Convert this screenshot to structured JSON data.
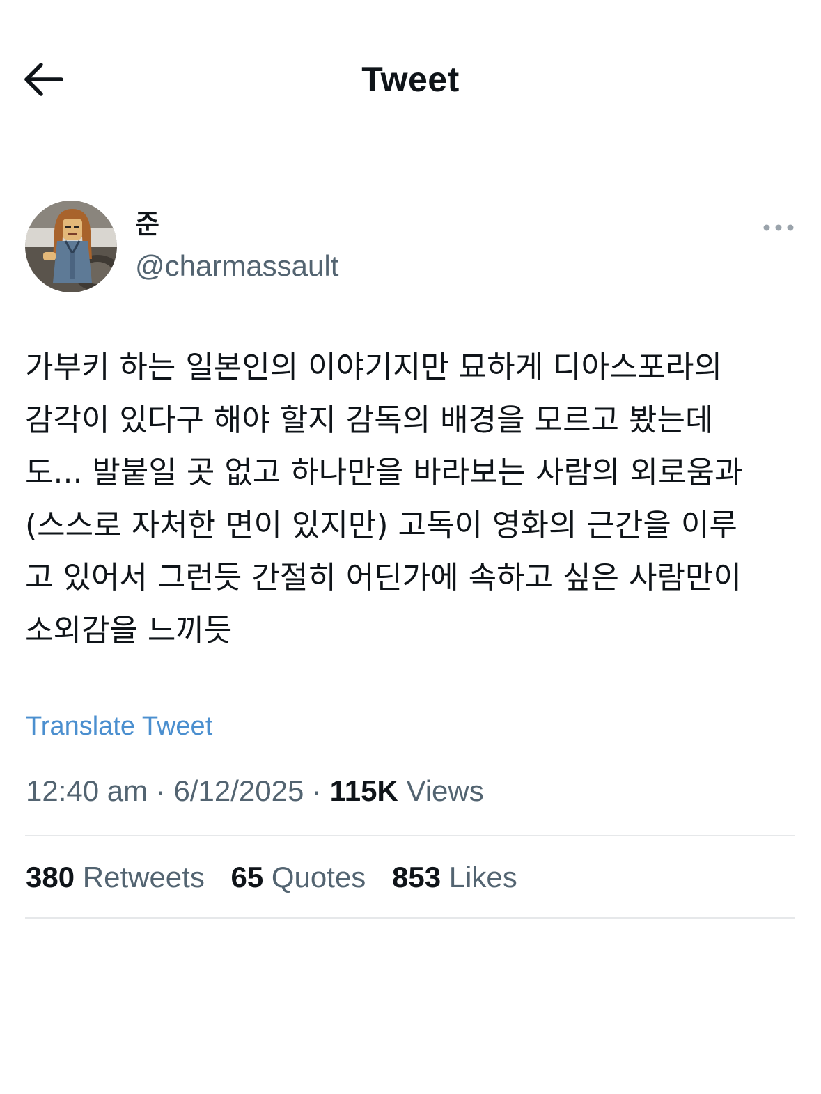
{
  "header": {
    "title": "Tweet",
    "back_icon": "arrow-left-icon"
  },
  "author": {
    "display_name": "준",
    "handle": "@charmassault",
    "avatar_icon": "avatar-image",
    "more_icon": "more-options-icon"
  },
  "tweet": {
    "lines": [
      "가부키 하는 일본인의 이야기지만 묘하게 디아스포라의",
      "감각이 있다구 해야 할지 감독의 배경을 모르고 봤는데",
      "도... 발붙일 곳 없고 하나만을 바라보는 사람의 외로움과",
      "(스스로 자처한 면이 있지만) 고독이 영화의 근간을 이루",
      "고 있어서 그런듯 간절히 어딘가에 속하고 싶은 사람만이",
      "소외감을 느끼듯"
    ],
    "translate_label": "Translate Tweet"
  },
  "meta": {
    "time": "12:40 am",
    "separator": "·",
    "date": "6/12/2025",
    "views_count": "115K",
    "views_label": "Views"
  },
  "stats": {
    "retweets_count": "380",
    "retweets_label": "Retweets",
    "quotes_count": "65",
    "quotes_label": "Quotes",
    "likes_count": "853",
    "likes_label": "Likes"
  },
  "colors": {
    "text_primary": "#0f1419",
    "text_secondary": "#536471",
    "link": "#4b8fcf",
    "divider": "#e6e8ea"
  }
}
